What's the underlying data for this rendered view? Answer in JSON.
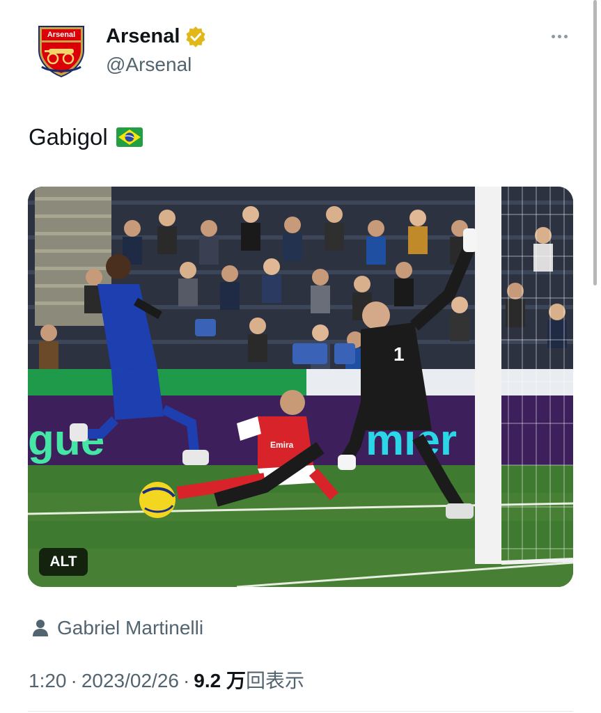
{
  "author": {
    "display_name": "Arsenal",
    "handle": "@Arsenal",
    "avatar_icon": "arsenal-crest-icon",
    "verified_icon": "verified-badge-icon",
    "avatar_text": "Arsenal",
    "verified_color": "#e2b719"
  },
  "tweet": {
    "text": "Gabigol",
    "flag_icon": "brazil-flag-icon"
  },
  "media": {
    "alt_label": "ALT",
    "board_texts": [
      "gue",
      "mier"
    ]
  },
  "tagged": {
    "icon": "person-icon",
    "name": "Gabriel Martinelli"
  },
  "meta": {
    "time": "1:20",
    "date": "2023/02/26",
    "views_count": "9.2 万",
    "views_label": "回表示",
    "separator": "·"
  },
  "menu": {
    "icon": "more-options-icon"
  }
}
